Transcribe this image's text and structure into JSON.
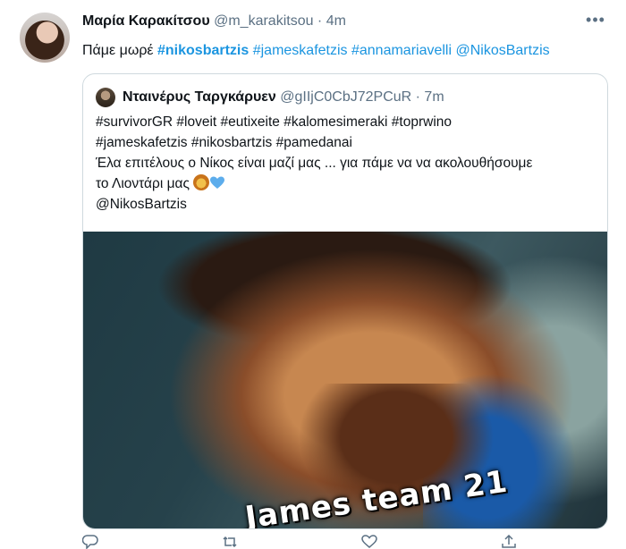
{
  "tweet": {
    "author_name": "Μαρία Καρακίτσου",
    "author_handle": "@m_karakitsou · 4m",
    "text_plain": "Πάμε μωρέ ",
    "text_hashtag_bold": "#nikosbartzis",
    "text_links": " #jameskafetzis #annamariavelli @NikosBartzis"
  },
  "quote": {
    "author_name": "Νταινέρυς Ταργκάρυεν",
    "author_handle": "@gIIjC0CbJ72PCuR · 7m",
    "lines": [
      "#survivorGR #loveit #eutixeite #kalomesimeraki #toprwino",
      "#jameskafetzis #nikosbartzis #pamedanai",
      "Έλα επιτέλους ο Νίκος είναι μαζί μας ... για πάμε να να ακολουθήσουμε",
      "το Λιοντάρι μας",
      "@NikosBartzis"
    ],
    "image_watermark": "James team 21"
  },
  "colors": {
    "link": "#1b95e0",
    "text": "#0f1419",
    "secondary": "#5b7083",
    "border": "#cfd9de"
  },
  "icons": [
    "more-icon",
    "lion-emoji",
    "blue-heart-emoji",
    "reply-icon",
    "retweet-icon",
    "like-icon",
    "share-icon"
  ]
}
